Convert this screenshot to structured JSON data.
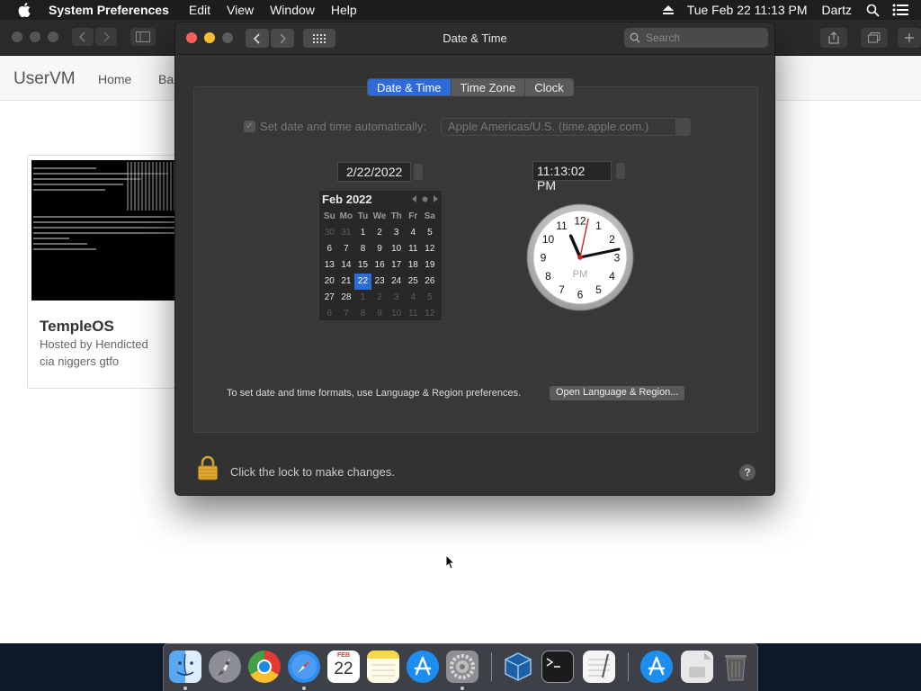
{
  "menubar": {
    "app_name": "System Preferences",
    "menus": [
      "Edit",
      "View",
      "Window",
      "Help"
    ],
    "datetime": "Tue Feb 22  11:13 PM",
    "user": "Dartz"
  },
  "browser": {
    "site_brand": "UserVM",
    "nav_links": [
      "Home",
      "Ba"
    ],
    "card": {
      "title": "TempleOS",
      "line1": "Hosted by Hendicted",
      "line2": "cia niggers gtfo"
    }
  },
  "window": {
    "title": "Date & Time",
    "search_placeholder": "Search",
    "tabs": [
      {
        "label": "Date & Time",
        "active": true
      },
      {
        "label": "Time Zone",
        "active": false
      },
      {
        "label": "Clock",
        "active": false
      }
    ],
    "auto_label": "Set date and time automatically:",
    "server": "Apple Americas/U.S. (time.apple.com.)",
    "date_value": "2/22/2022",
    "time_value": "11:13:02 PM",
    "calendar": {
      "month_label": "Feb 2022",
      "weekdays": [
        "Su",
        "Mo",
        "Tu",
        "We",
        "Th",
        "Fr",
        "Sa"
      ],
      "days": [
        {
          "d": "30",
          "dim": true
        },
        {
          "d": "31",
          "dim": true
        },
        {
          "d": "1"
        },
        {
          "d": "2"
        },
        {
          "d": "3"
        },
        {
          "d": "4"
        },
        {
          "d": "5"
        },
        {
          "d": "6"
        },
        {
          "d": "7"
        },
        {
          "d": "8"
        },
        {
          "d": "9"
        },
        {
          "d": "10"
        },
        {
          "d": "11"
        },
        {
          "d": "12"
        },
        {
          "d": "13"
        },
        {
          "d": "14"
        },
        {
          "d": "15"
        },
        {
          "d": "16"
        },
        {
          "d": "17"
        },
        {
          "d": "18"
        },
        {
          "d": "19"
        },
        {
          "d": "20"
        },
        {
          "d": "21"
        },
        {
          "d": "22",
          "today": true
        },
        {
          "d": "23"
        },
        {
          "d": "24"
        },
        {
          "d": "25"
        },
        {
          "d": "26"
        },
        {
          "d": "27"
        },
        {
          "d": "28"
        },
        {
          "d": "1",
          "dim": true
        },
        {
          "d": "2",
          "dim": true
        },
        {
          "d": "3",
          "dim": true
        },
        {
          "d": "4",
          "dim": true
        },
        {
          "d": "5",
          "dim": true
        },
        {
          "d": "6",
          "dim": true
        },
        {
          "d": "7",
          "dim": true
        },
        {
          "d": "8",
          "dim": true
        },
        {
          "d": "9",
          "dim": true
        },
        {
          "d": "10",
          "dim": true
        },
        {
          "d": "11",
          "dim": true
        },
        {
          "d": "12",
          "dim": true
        }
      ]
    },
    "clock": {
      "numbers": [
        "12",
        "1",
        "2",
        "3",
        "4",
        "5",
        "6",
        "7",
        "8",
        "9",
        "10",
        "11"
      ],
      "period": "PM",
      "hour": 11,
      "minute": 13,
      "second": 2
    },
    "hint_text": "To set date and time formats, use Language & Region preferences.",
    "lang_button": "Open Language & Region...",
    "lock_text": "Click the lock to make changes.",
    "help_label": "?"
  },
  "dock": {
    "apps": [
      "finder",
      "launchpad",
      "chrome",
      "safari",
      "calendar",
      "notes",
      "app-store",
      "system-preferences",
      "virtualbox",
      "terminal",
      "textedit",
      "app-store-downloads",
      "document",
      "trash"
    ],
    "calendar_month": "FEB",
    "calendar_day": "22"
  },
  "colors": {
    "accent": "#2f6ad9",
    "menubar": "#1e1e1e",
    "window_bg": "#323232",
    "clock_second_hand": "#d02020"
  }
}
